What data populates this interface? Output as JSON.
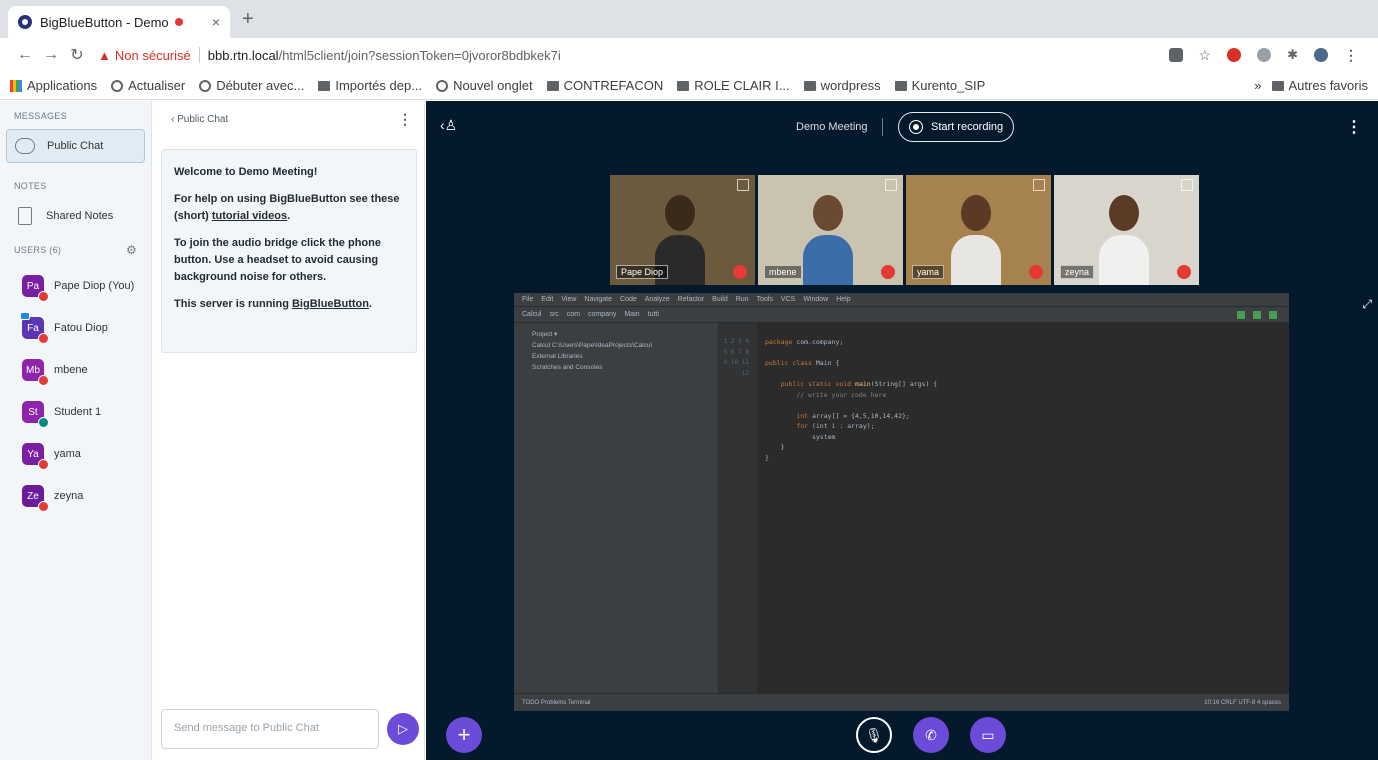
{
  "browser": {
    "tab_title": "BigBlueButton - Demo",
    "tab_close": "×",
    "new_tab": "+",
    "insecure_label": "Non sécurisé",
    "url_host": "bbb.rtn.local",
    "url_path": "/html5client/join?sessionToken=0jvoror8bdbkek7i",
    "bookmarks": [
      "Applications",
      "Actualiser",
      "Débuter avec...",
      "Importés dep...",
      "Nouvel onglet",
      "CONTREFACON",
      "ROLE CLAIR I...",
      "wordpress",
      "Kurento_SIP"
    ],
    "other_bookmarks": "Autres favoris",
    "more_bookmarks": "»"
  },
  "userlist": {
    "messages_title": "MESSAGES",
    "public_chat": "Public Chat",
    "notes_title": "NOTES",
    "shared_notes": "Shared Notes",
    "users_title": "USERS (6)",
    "users": [
      {
        "initials": "Pa",
        "name": "Pape Diop (You)",
        "color": "#7b1fa2",
        "mic": "muted"
      },
      {
        "initials": "Fa",
        "name": "Fatou Diop",
        "color": "#5e35b1",
        "mic": "muted",
        "presenter": true
      },
      {
        "initials": "Mb",
        "name": "mbene",
        "color": "#8e24aa",
        "mic": "muted"
      },
      {
        "initials": "St",
        "name": "Student 1",
        "color": "#8e24aa",
        "mic": "ok"
      },
      {
        "initials": "Ya",
        "name": "yama",
        "color": "#7b1fa2",
        "mic": "muted"
      },
      {
        "initials": "Ze",
        "name": "zeyna",
        "color": "#6a1b9a",
        "mic": "muted"
      }
    ]
  },
  "chat": {
    "back_label": "‹  Public Chat",
    "welcome_title": "Welcome to Demo Meeting!",
    "help_prefix": "For help on using BigBlueButton see these (short) ",
    "help_link": "tutorial videos",
    "help_suffix": ".",
    "audio_text": "To join the audio bridge click the phone button. Use a headset to avoid causing background noise for others.",
    "server_prefix": "This server is running ",
    "server_link": "BigBlueButton",
    "server_suffix": ".",
    "input_placeholder": "Send message to Public Chat"
  },
  "meeting": {
    "name": "Demo Meeting",
    "record_label": "Start recording",
    "webcams": [
      {
        "name": "Pape Diop",
        "bg": "#6b5a3e",
        "skin": "#3a2a1c",
        "shirt": "#2a2a2a"
      },
      {
        "name": "mbene",
        "bg": "#c9c3b0",
        "skin": "#6b4a32",
        "shirt": "#3b6ea8"
      },
      {
        "name": "yama",
        "bg": "#a6824f",
        "skin": "#5a3a24",
        "shirt": "#e8e6e1"
      },
      {
        "name": "zeyna",
        "bg": "#d8d6cc",
        "skin": "#5c3b26",
        "shirt": "#f0f0ee"
      }
    ]
  },
  "ide": {
    "menu": [
      "File",
      "Edit",
      "View",
      "Navigate",
      "Code",
      "Analyze",
      "Refactor",
      "Build",
      "Run",
      "Tools",
      "VCS",
      "Window",
      "Help"
    ],
    "toolbar": [
      "Calcul",
      "src",
      "com",
      "company",
      "Main",
      "tutti"
    ],
    "project_items": [
      "Project ▾",
      "Calcul C:\\Users\\Pape\\IdeaProjects\\Calcul",
      "External Libraries",
      "Scratches and Consoles"
    ],
    "line_numbers": "1\n2\n3\n4\n5\n6\n7\n8\n9\n10\n11\n12",
    "status_left": "TODO   Problems   Terminal",
    "status_right": "10:16   CRLF   UTF-8   4 spaces"
  }
}
